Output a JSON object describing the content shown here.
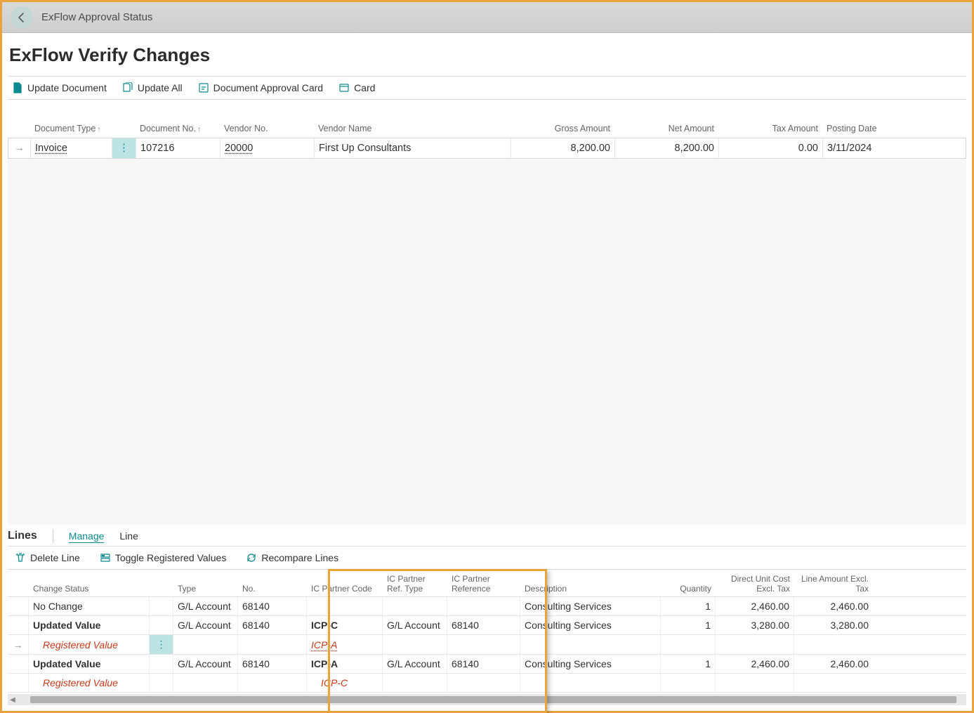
{
  "titlebar": {
    "breadcrumb": "ExFlow Approval Status"
  },
  "page": {
    "title": "ExFlow Verify Changes"
  },
  "actions": {
    "update_document": "Update Document",
    "update_all": "Update All",
    "approval_card": "Document Approval Card",
    "card": "Card"
  },
  "main_grid": {
    "headers": {
      "doc_type": "Document Type",
      "doc_no": "Document No.",
      "vendor_no": "Vendor No.",
      "vendor_name": "Vendor Name",
      "gross": "Gross Amount",
      "net": "Net Amount",
      "tax": "Tax Amount",
      "posting_date": "Posting Date"
    },
    "row": {
      "doc_type": "Invoice",
      "doc_no": "107216",
      "vendor_no": "20000",
      "vendor_name": "First Up Consultants",
      "gross": "8,200.00",
      "net": "8,200.00",
      "tax": "0.00",
      "posting_date": "3/11/2024"
    }
  },
  "lines_tabs": {
    "lines": "Lines",
    "manage": "Manage",
    "line": "Line"
  },
  "lines_actions": {
    "delete": "Delete Line",
    "toggle": "Toggle Registered Values",
    "recompare": "Recompare Lines"
  },
  "lines_grid": {
    "headers": {
      "change_status": "Change Status",
      "type": "Type",
      "no": "No.",
      "ic_code": "IC Partner Code",
      "ic_ref_type": "IC Partner Ref. Type",
      "ic_ref": "IC Partner Reference",
      "description": "Description",
      "quantity": "Quantity",
      "unit_cost": "Direct Unit Cost Excl. Tax",
      "line_amount": "Line Amount Excl. Tax"
    },
    "rows": [
      {
        "change_status": "No Change",
        "type": "G/L Account",
        "no": "68140",
        "ic_code": "",
        "ic_ref_type": "",
        "ic_ref": "",
        "description": "Consulting Services",
        "quantity": "1",
        "unit_cost": "2,460.00",
        "line_amount": "2,460.00",
        "bold": false,
        "reg": false,
        "active": false
      },
      {
        "change_status": "Updated Value",
        "type": "G/L Account",
        "no": "68140",
        "ic_code": "ICP-C",
        "ic_ref_type": "G/L Account",
        "ic_ref": "68140",
        "description": "Consulting Services",
        "quantity": "1",
        "unit_cost": "3,280.00",
        "line_amount": "3,280.00",
        "bold": true,
        "reg": false,
        "active": false
      },
      {
        "change_status": "Registered Value",
        "type": "",
        "no": "",
        "ic_code": "ICP-A",
        "ic_ref_type": "",
        "ic_ref": "",
        "description": "",
        "quantity": "",
        "unit_cost": "",
        "line_amount": "",
        "bold": false,
        "reg": true,
        "active": true,
        "ic_old": true
      },
      {
        "change_status": "Updated Value",
        "type": "G/L Account",
        "no": "68140",
        "ic_code": "ICP-A",
        "ic_ref_type": "G/L Account",
        "ic_ref": "68140",
        "description": "Consulting Services",
        "quantity": "1",
        "unit_cost": "2,460.00",
        "line_amount": "2,460.00",
        "bold": true,
        "reg": false,
        "active": false
      },
      {
        "change_status": "Registered Value",
        "type": "",
        "no": "",
        "ic_code": "ICP-C",
        "ic_ref_type": "",
        "ic_ref": "",
        "description": "",
        "quantity": "",
        "unit_cost": "",
        "line_amount": "",
        "bold": false,
        "reg": true,
        "active": false
      }
    ]
  }
}
